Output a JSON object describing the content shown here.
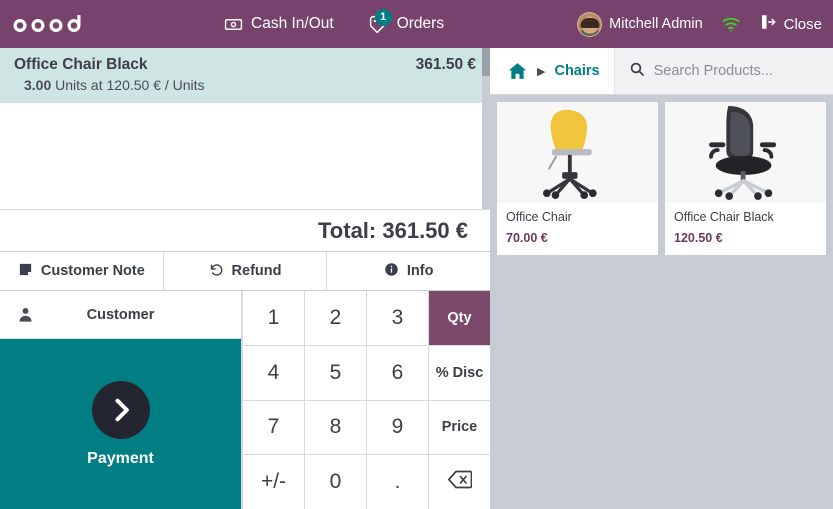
{
  "topbar": {
    "logo_text": "odoo",
    "cash_inout_label": "Cash In/Out",
    "cash_inout_icon": "money-bill-icon",
    "orders_label": "Orders",
    "orders_icon": "ticket-icon",
    "orders_badge": "1",
    "user_name": "Mitchell Admin",
    "avatar_icon": "user-avatar",
    "wifi_icon": "wifi-icon",
    "close_label": "Close",
    "close_icon": "sign-out-icon",
    "bg_color": "#77426b",
    "accent_color": "#017e84"
  },
  "order": {
    "lines": [
      {
        "name": "Office Chair Black",
        "price": "361.50 €",
        "qty": "3.00",
        "detail": "Units at 120.50 € / Units",
        "selected": true
      }
    ],
    "total_label": "Total: 361.50 €",
    "actions": [
      {
        "label": "Customer Note",
        "icon": "note-icon"
      },
      {
        "label": "Refund",
        "icon": "undo-icon"
      },
      {
        "label": "Info",
        "icon": "info-circle-icon"
      }
    ],
    "customer_label": "Customer",
    "customer_icon": "person-icon",
    "payment_label": "Payment",
    "payment_icon": "chevron-right-icon"
  },
  "numpad": {
    "keys": [
      {
        "label": "1",
        "name": "numpad-1",
        "type": "digit"
      },
      {
        "label": "2",
        "name": "numpad-2",
        "type": "digit"
      },
      {
        "label": "3",
        "name": "numpad-3",
        "type": "digit"
      },
      {
        "label": "Qty",
        "name": "numpad-qty",
        "type": "mode",
        "active": true
      },
      {
        "label": "4",
        "name": "numpad-4",
        "type": "digit"
      },
      {
        "label": "5",
        "name": "numpad-5",
        "type": "digit"
      },
      {
        "label": "6",
        "name": "numpad-6",
        "type": "digit"
      },
      {
        "label": "% Disc",
        "name": "numpad-discount",
        "type": "mode"
      },
      {
        "label": "7",
        "name": "numpad-7",
        "type": "digit"
      },
      {
        "label": "8",
        "name": "numpad-8",
        "type": "digit"
      },
      {
        "label": "9",
        "name": "numpad-9",
        "type": "digit"
      },
      {
        "label": "Price",
        "name": "numpad-price",
        "type": "mode"
      },
      {
        "label": "+/-",
        "name": "numpad-plusminus",
        "type": "digit"
      },
      {
        "label": "0",
        "name": "numpad-0",
        "type": "digit"
      },
      {
        "label": ".",
        "name": "numpad-decimal",
        "type": "digit"
      },
      {
        "label": "⌫",
        "name": "numpad-backspace",
        "type": "backspace"
      }
    ],
    "active_mode": "Qty"
  },
  "products": {
    "breadcrumb": {
      "home_icon": "home-icon",
      "separator": "▶",
      "current": "Chairs"
    },
    "search": {
      "icon": "search-icon",
      "placeholder": "Search Products...",
      "value": ""
    },
    "items": [
      {
        "name": "Office Chair",
        "price": "70.00 €",
        "image": "yellow-office-chair"
      },
      {
        "name": "Office Chair Black",
        "price": "120.50 €",
        "image": "black-office-chair"
      }
    ]
  }
}
